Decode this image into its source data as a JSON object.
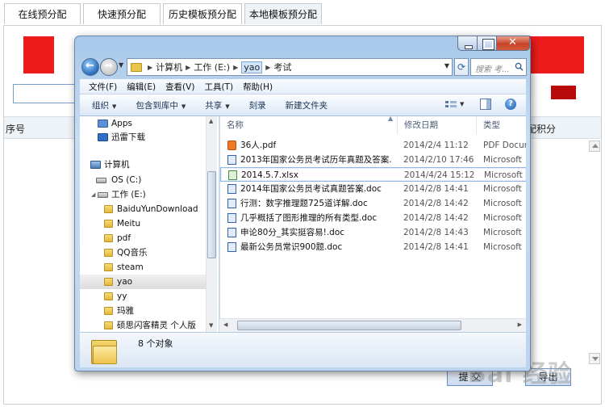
{
  "page": {
    "tabs": [
      "在线预分配",
      "快速预分配",
      "历史模板预分配",
      "本地模板预分配"
    ],
    "table_headers": {
      "serial": "序号",
      "score": "配积分"
    },
    "buttons": {
      "submit": "提 交",
      "export": "导出"
    },
    "watermark": "Bai  经验"
  },
  "dialog": {
    "breadcrumbs": [
      "计算机",
      "工作 (E:)",
      "yao",
      "考试"
    ],
    "search_placeholder": "搜索 考...",
    "menu": [
      "文件(F)",
      "编辑(E)",
      "查看(V)",
      "工具(T)",
      "帮助(H)"
    ],
    "toolbar": [
      "组织",
      "包含到库中",
      "共享",
      "刻录",
      "新建文件夹"
    ],
    "nav": [
      {
        "label": "Apps",
        "icon": "apps-icon"
      },
      {
        "label": "迅雷下载",
        "icon": "xunlei-icon"
      },
      {
        "label": "计算机",
        "icon": "computer-icon"
      },
      {
        "label": "OS (C:)",
        "icon": "drive-icon"
      },
      {
        "label": "工作 (E:)",
        "icon": "drive-icon"
      },
      {
        "label": "BaiduYunDownload",
        "icon": "folder-icon"
      },
      {
        "label": "Meitu",
        "icon": "folder-icon"
      },
      {
        "label": "pdf",
        "icon": "folder-icon"
      },
      {
        "label": "QQ音乐",
        "icon": "folder-icon"
      },
      {
        "label": "steam",
        "icon": "folder-icon"
      },
      {
        "label": "yao",
        "icon": "folder-icon"
      },
      {
        "label": "yy",
        "icon": "folder-icon"
      },
      {
        "label": "玛雅",
        "icon": "folder-icon"
      },
      {
        "label": "硕思闪客精灵 个人版",
        "icon": "folder-icon"
      }
    ],
    "columns": {
      "name": "名称",
      "date": "修改日期",
      "type": "类型"
    },
    "files": [
      {
        "name": "36人.pdf",
        "date": "2014/2/4 11:12",
        "type": "PDF Docum",
        "kind": "pdf"
      },
      {
        "name": "2013年国家公务员考试历年真题及答案...",
        "date": "2014/2/10 17:46",
        "type": "Microsoft",
        "kind": "doc"
      },
      {
        "name": "2014.5.7.xlsx",
        "date": "2014/4/24 15:12",
        "type": "Microsoft",
        "kind": "xls"
      },
      {
        "name": "2014年国家公务员考试真题答案.doc",
        "date": "2014/2/8 14:41",
        "type": "Microsoft",
        "kind": "doc"
      },
      {
        "name": "行测：数字推理题725道详解.doc",
        "date": "2014/2/8 14:42",
        "type": "Microsoft",
        "kind": "doc"
      },
      {
        "name": "几乎概括了图形推理的所有类型.doc",
        "date": "2014/2/8 14:42",
        "type": "Microsoft",
        "kind": "doc"
      },
      {
        "name": "申论80分_其实挺容易!.doc",
        "date": "2014/2/8 14:43",
        "type": "Microsoft",
        "kind": "doc"
      },
      {
        "name": "最新公务员常识900题.doc",
        "date": "2014/2/8 14:41",
        "type": "Microsoft",
        "kind": "doc"
      }
    ],
    "item_count": "8 个对象"
  }
}
